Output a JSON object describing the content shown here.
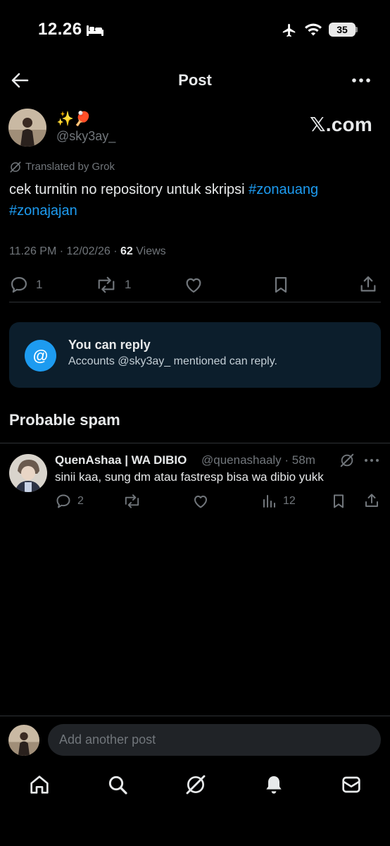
{
  "status_bar": {
    "time": "12.26",
    "battery": "35"
  },
  "header": {
    "title": "Post"
  },
  "post": {
    "author_name_emoji": "✨🏓",
    "handle": "@sky3ay_",
    "source_logo": "𝕏.com",
    "translated_label": "Translated by Grok",
    "text": "cek turnitin no repository untuk skripsi ",
    "hashtags": [
      "#zonauang",
      "#zonajajan"
    ],
    "time": "11.26 PM · 12/02/26 · ",
    "views_count": "62",
    "views_label": " Views",
    "reply_count": "1",
    "repost_count": "1"
  },
  "reply_restriction": {
    "icon": "@",
    "title": "You can reply",
    "subtitle": "Accounts @sky3ay_ mentioned can reply."
  },
  "section": {
    "title": "Probable spam"
  },
  "reply": {
    "name": "QuenAshaa | WA DIBIO",
    "handle_time": "@quenashaaly · 58m",
    "text": "sinii kaa, sung dm atau fastresp bisa wa dibio yukk",
    "reply_count": "2",
    "views": "12"
  },
  "composer": {
    "placeholder": "Add another post"
  },
  "colors": {
    "accent": "#1d9bf0",
    "muted": "#71767b",
    "background": "#000000",
    "card": "#0c1e2c"
  }
}
